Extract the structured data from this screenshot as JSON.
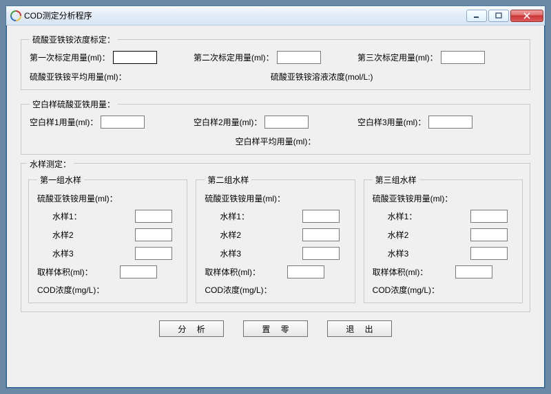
{
  "window": {
    "title": "COD测定分析程序"
  },
  "section1": {
    "legend": "硫酸亚铁铵浓度标定：",
    "cal1_label": "第一次标定用量(ml)：",
    "cal2_label": "第二次标定用量(ml)：",
    "cal3_label": "第三次标定用量(ml)：",
    "avg_label": "硫酸亚铁铵平均用量(ml)：",
    "conc_label": "硫酸亚铁铵溶液浓度(mol/L:)",
    "cal1": "",
    "cal2": "",
    "cal3": ""
  },
  "section2": {
    "legend": "空白样硫酸亚铁用量：",
    "b1_label": "空白样1用量(ml)：",
    "b2_label": "空白样2用量(ml)：",
    "b3_label": "空白样3用量(ml)：",
    "avg_label": "空白样平均用量(ml)：",
    "b1": "",
    "b2": "",
    "b3": ""
  },
  "section3": {
    "legend": "水样测定：",
    "group_legends": [
      "第一组水样",
      "第二组水样",
      "第三组水样"
    ],
    "usage_label": "硫酸亚铁铵用量(ml)：",
    "s1_label": "水样1：",
    "s2_label": "水样2",
    "s3_label": "水样3",
    "vol_label": "取样体积(ml)：",
    "cod_label": "COD浓度(mg/L)：",
    "g1": {
      "s1": "",
      "s2": "",
      "s3": "",
      "vol": ""
    },
    "g2": {
      "s1": "",
      "s2": "",
      "s3": "",
      "vol": ""
    },
    "g3": {
      "s1": "",
      "s2": "",
      "s3": "",
      "vol": ""
    }
  },
  "buttons": {
    "analyze": "分 析",
    "reset": "置 零",
    "exit": "退 出"
  }
}
